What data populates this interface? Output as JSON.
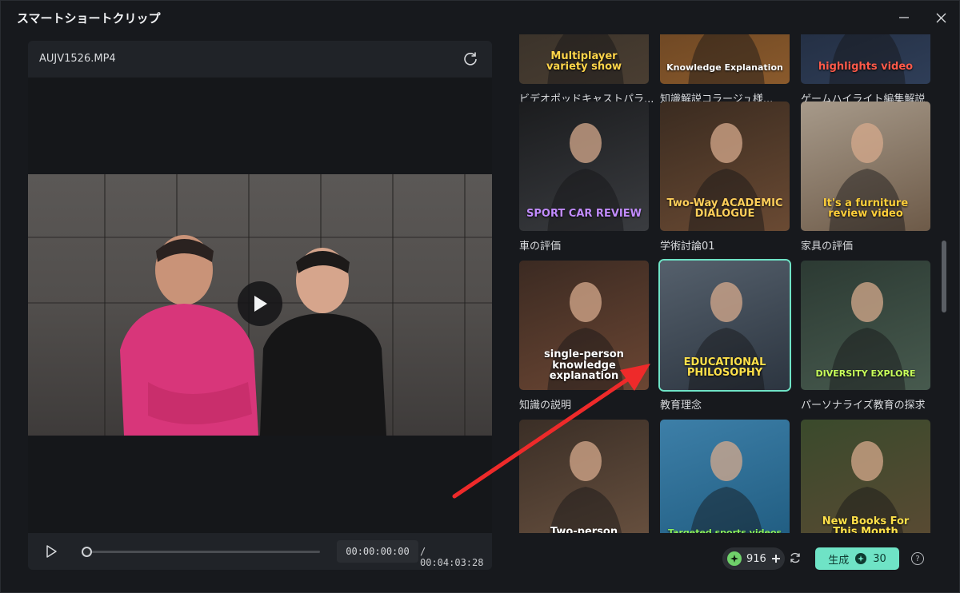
{
  "window": {
    "title": "スマートショートクリップ"
  },
  "video": {
    "file_name": "AUJV1526.MP4",
    "current_time": "00:00:00:00",
    "total_time": "/ 00:04:03:28",
    "progress": 0.0
  },
  "templates": [
    {
      "label": "ビデオポッドキャストパラ...",
      "overlay": [
        "Multiplayer",
        "variety show"
      ],
      "bg": [
        "#2f2a24",
        "#4a3e32"
      ],
      "overlay_color": "#ffd54a"
    },
    {
      "label": "知識解説コラージュ様...",
      "overlay": [
        "Knowledge Explanation"
      ],
      "bg": [
        "#5a3a1e",
        "#8a5a2c"
      ],
      "overlay_color": "#ffffff"
    },
    {
      "label": "ゲームハイライト編集解説",
      "overlay": [
        "highlights video"
      ],
      "bg": [
        "#1b2434",
        "#2f3e58"
      ],
      "overlay_color": "#ff5a4a"
    },
    {
      "label": "車の評価",
      "overlay": [
        "SPORT CAR REVIEW"
      ],
      "bg": [
        "#1b1c1e",
        "#3a3c40"
      ],
      "overlay_color": "#c28cff"
    },
    {
      "label": "学術討論01",
      "overlay": [
        "Two-Way ACADEMIC",
        "DIALOGUE"
      ],
      "bg": [
        "#3a2b20",
        "#6a4a33"
      ],
      "overlay_color": "#ffcf5a"
    },
    {
      "label": "家具の評価",
      "overlay": [
        "It's a furniture",
        "review video"
      ],
      "bg": [
        "#a79a8a",
        "#6d5a48"
      ],
      "overlay_color": "#ffcf3a"
    },
    {
      "label": "知識の説明",
      "overlay": [
        "single-person",
        "knowledge",
        "explanation"
      ],
      "bg": [
        "#3b2a22",
        "#6b4633"
      ],
      "overlay_color": "#ffffff"
    },
    {
      "label": "教育理念",
      "overlay": [
        "EDUCATIONAL",
        "PHILOSOPHY"
      ],
      "bg": [
        "#55606c",
        "#2c3540"
      ],
      "overlay_color": "#ffe14a",
      "selected": true
    },
    {
      "label": "パーソナライズ教育の探求",
      "overlay": [
        "DIVERSITY EXPLORE"
      ],
      "bg": [
        "#2c3a33",
        "#475a4e"
      ],
      "overlay_color": "#c8ff5a"
    },
    {
      "label": "",
      "overlay": [
        "Two-person"
      ],
      "bg": [
        "#3a2e26",
        "#6a5240"
      ],
      "overlay_color": "#ffffff"
    },
    {
      "label": "",
      "overlay": [
        "Targeted sports videos"
      ],
      "bg": [
        "#3d7fa8",
        "#1f5b7f"
      ],
      "overlay_color": "#8cf05a"
    },
    {
      "label": "",
      "overlay": [
        "New Books For",
        "This Month"
      ],
      "bg": [
        "#3a4a2c",
        "#5b4a33"
      ],
      "overlay_color": "#ffe14a"
    }
  ],
  "footer": {
    "credits": "916",
    "generate_label": "生成",
    "generate_cost": "30",
    "help": "?"
  },
  "colors": {
    "accent": "#6fe3c6",
    "arrow": "#ee2a2a"
  }
}
